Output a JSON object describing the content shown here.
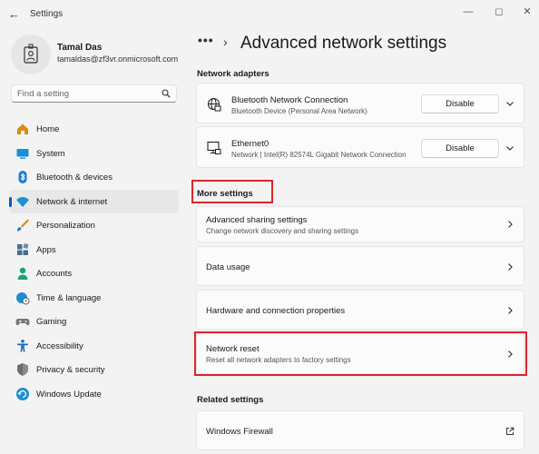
{
  "window": {
    "title": "Settings",
    "back_icon": "arrow-left-icon",
    "minimize_icon": "minimize-icon",
    "maximize_icon": "maximize-icon",
    "close_icon": "close-icon"
  },
  "user": {
    "name": "Tamal Das",
    "email": "tamaldas@zf3vr.onmicrosoft.com",
    "avatar_icon": "id-badge-icon"
  },
  "search": {
    "placeholder": "Find a setting",
    "icon": "search-icon"
  },
  "nav": [
    {
      "label": "Home",
      "icon": "home-icon",
      "color": "#d88a1c"
    },
    {
      "label": "System",
      "icon": "monitor-icon",
      "color": "#1a8fd6"
    },
    {
      "label": "Bluetooth & devices",
      "icon": "bluetooth-icon",
      "color": "#1a7bd6"
    },
    {
      "label": "Network & internet",
      "icon": "wifi-icon",
      "color": "#1a8fd6",
      "active": true
    },
    {
      "label": "Personalization",
      "icon": "brush-icon",
      "color": "#d88a1c"
    },
    {
      "label": "Apps",
      "icon": "apps-icon",
      "color": "#4a6d8c"
    },
    {
      "label": "Accounts",
      "icon": "person-icon",
      "color": "#1aa36f"
    },
    {
      "label": "Time & language",
      "icon": "globe-clock-icon",
      "color": "#1a8fd6"
    },
    {
      "label": "Gaming",
      "icon": "gamepad-icon",
      "color": "#777777"
    },
    {
      "label": "Accessibility",
      "icon": "accessibility-icon",
      "color": "#1a6fc4"
    },
    {
      "label": "Privacy & security",
      "icon": "shield-icon",
      "color": "#777777"
    },
    {
      "label": "Windows Update",
      "icon": "update-icon",
      "color": "#1a8fd6"
    }
  ],
  "header": {
    "breadcrumb_more": "•••",
    "separator": "›",
    "title": "Advanced network settings"
  },
  "network_adapters": {
    "label": "Network adapters",
    "items": [
      {
        "name": "Bluetooth Network Connection",
        "description": "Bluetooth Device (Personal Area Network)",
        "button": "Disable",
        "icon": "globe-network-icon"
      },
      {
        "name": "Ethernet0",
        "description": "Network | Intel(R) 82574L Gigabit Network Connection",
        "button": "Disable",
        "icon": "ethernet-icon"
      }
    ]
  },
  "more_settings": {
    "label": "More settings",
    "items": [
      {
        "title": "Advanced sharing settings",
        "subtitle": "Change network discovery and sharing settings"
      },
      {
        "title": "Data usage",
        "subtitle": ""
      },
      {
        "title": "Hardware and connection properties",
        "subtitle": ""
      },
      {
        "title": "Network reset",
        "subtitle": "Reset all network adapters to factory settings"
      }
    ]
  },
  "related_settings": {
    "label": "Related settings",
    "items": [
      {
        "title": "Windows Firewall",
        "icon": "external-link-icon"
      }
    ]
  },
  "colors": {
    "accent": "#005fb8",
    "highlight": "#e0242b",
    "background": "#f3f3f3",
    "card": "#fbfbfb"
  }
}
